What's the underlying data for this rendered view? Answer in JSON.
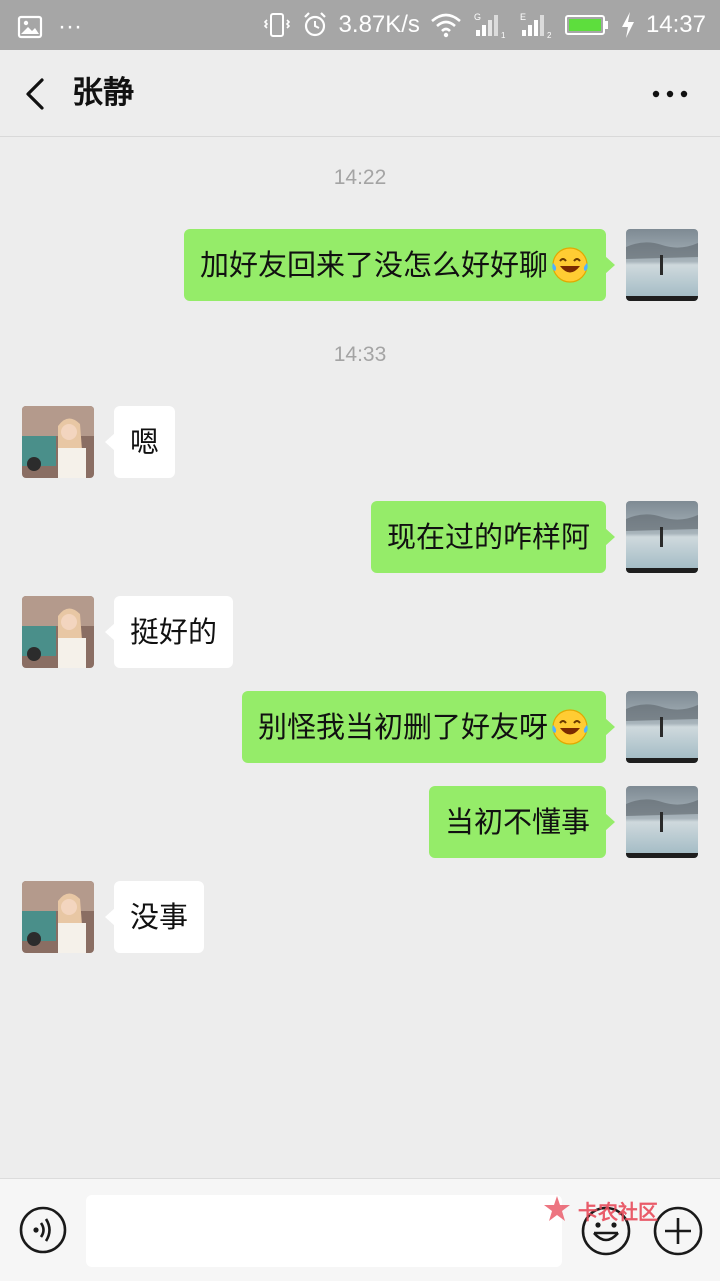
{
  "status_bar": {
    "network_speed": "3.87K/s",
    "time": "14:37",
    "more_glyph": "···",
    "sim1_label": "G",
    "sim2_label": "E"
  },
  "header": {
    "title": "张静"
  },
  "messages": [
    {
      "type": "time",
      "text": "14:22"
    },
    {
      "type": "msg",
      "sender": "me",
      "text": "加好友回来了没怎么好好聊",
      "emoji": "laughing-tears"
    },
    {
      "type": "time",
      "text": "14:33"
    },
    {
      "type": "msg",
      "sender": "them",
      "text": "嗯"
    },
    {
      "type": "msg",
      "sender": "me",
      "text": "现在过的咋样阿"
    },
    {
      "type": "msg",
      "sender": "them",
      "text": "挺好的"
    },
    {
      "type": "msg",
      "sender": "me",
      "text": "别怪我当初删了好友呀",
      "emoji": "laughing-tears"
    },
    {
      "type": "msg",
      "sender": "me",
      "text": "当初不懂事"
    },
    {
      "type": "msg",
      "sender": "them",
      "text": "没事"
    }
  ],
  "input": {
    "value": "",
    "placeholder": ""
  },
  "watermark": {
    "text": "卡农社区"
  },
  "colors": {
    "my_bubble": "#95ec69",
    "their_bubble": "#ffffff",
    "background": "#ededed",
    "status_bar": "#a6a6a6"
  }
}
